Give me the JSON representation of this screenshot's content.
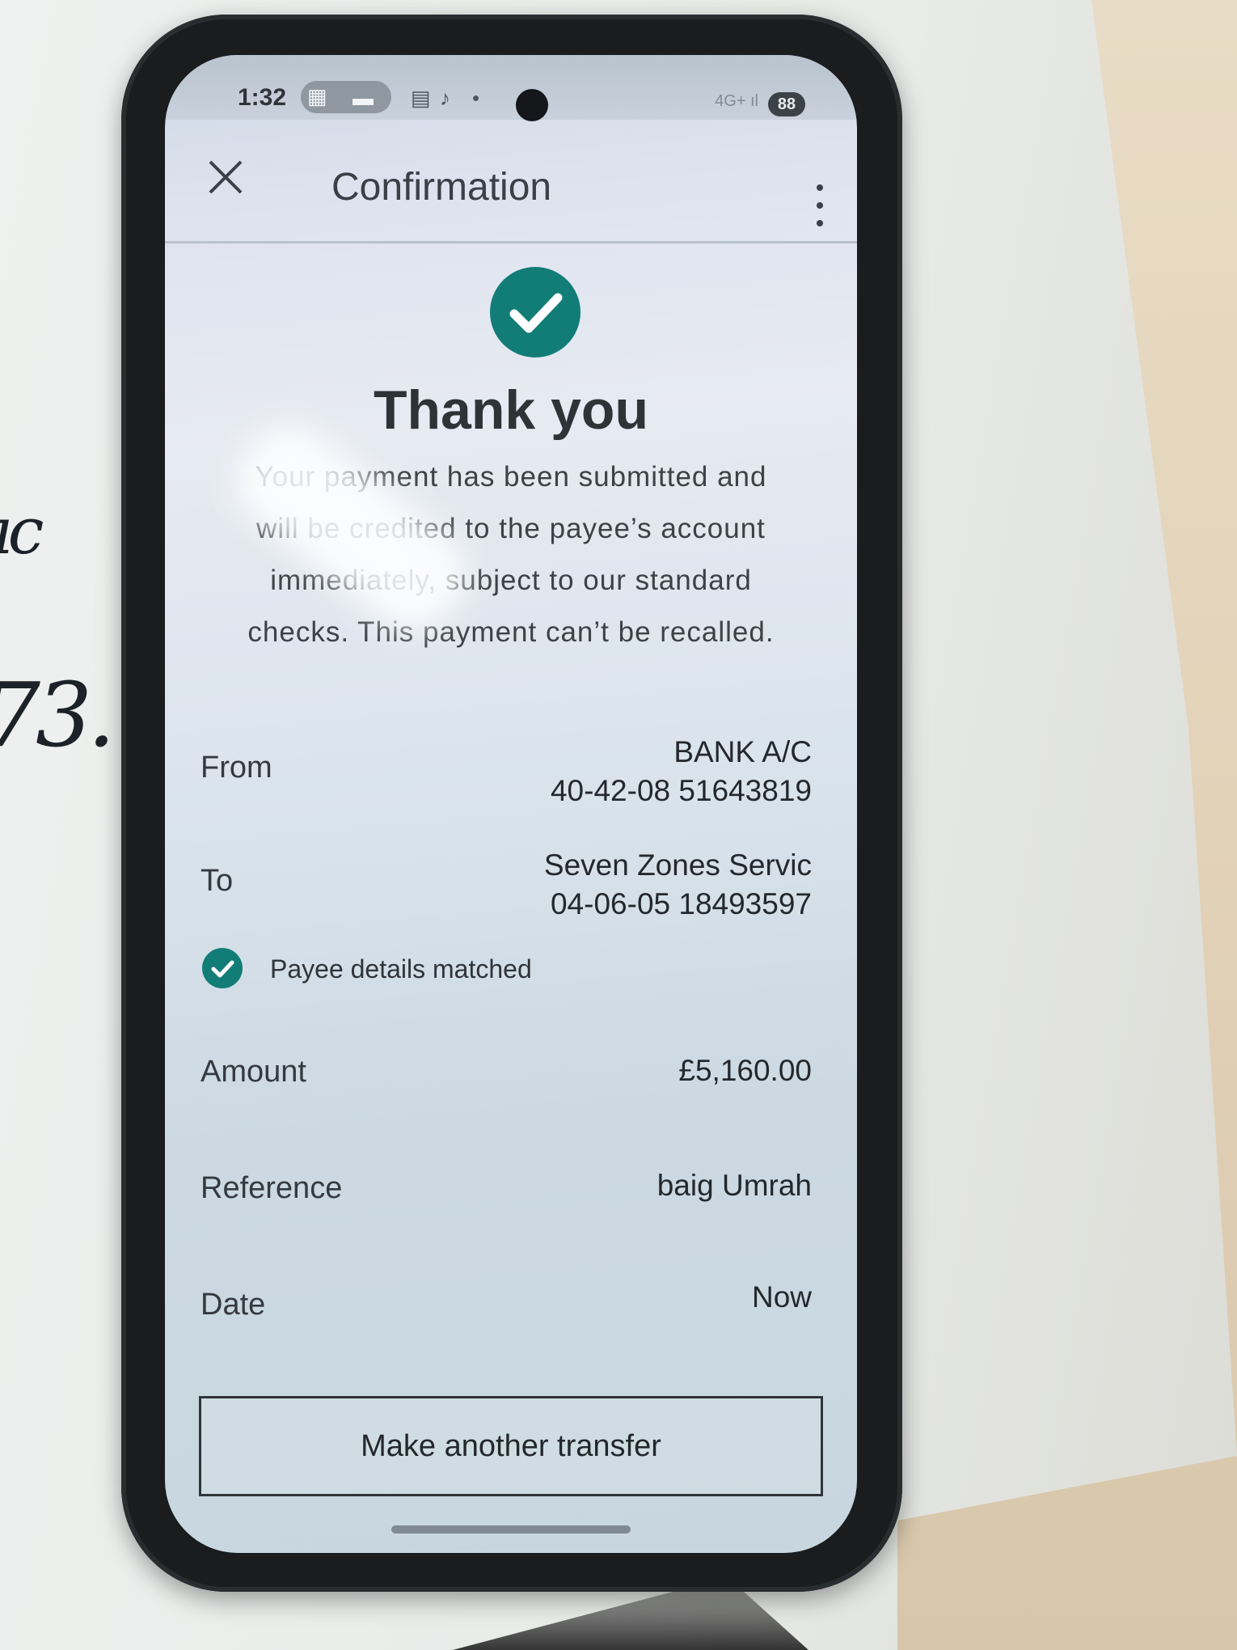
{
  "status_bar": {
    "time": "1:32",
    "battery": "88",
    "network": "4G+"
  },
  "header": {
    "title": "Confirmation",
    "close_icon": "close-icon",
    "menu_icon": "more-vertical-icon"
  },
  "confirmation": {
    "heading": "Thank you",
    "message_lines": [
      "Your payment has been submitted and",
      "will be credited to the payee’s account",
      "immediately, subject to our standard",
      "checks. This payment can’t be recalled."
    ]
  },
  "details": {
    "from_label": "From",
    "from_account_name": "BANK A/C",
    "from_account_number": "40-42-08 51643819",
    "to_label": "To",
    "to_name": "Seven Zones Servic",
    "to_account_number": "04-06-05 18493597",
    "payee_match_text": "Payee details matched",
    "amount_label": "Amount",
    "amount_value": "£5,160.00",
    "reference_label": "Reference",
    "reference_value": "baig Umrah",
    "date_label": "Date",
    "date_value": "Now"
  },
  "actions": {
    "make_another_transfer": "Make another transfer"
  },
  "colors": {
    "accent": "#127d77",
    "text": "#23282d"
  }
}
